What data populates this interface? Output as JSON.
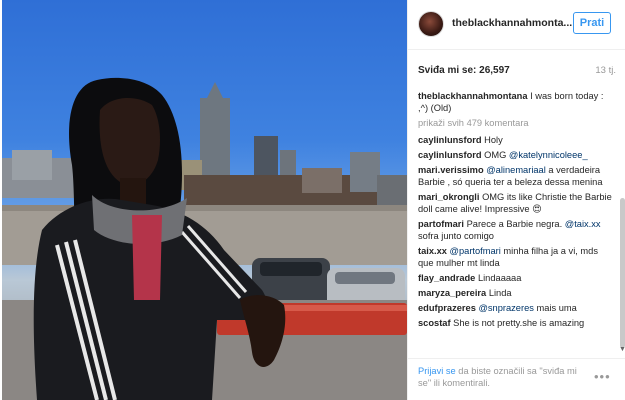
{
  "photo": {
    "alt_subject": "woman-on-parking-deck"
  },
  "header": {
    "username": "theblackhannahmonta...",
    "follow_label": "Prati"
  },
  "stats": {
    "likes_label": "Sviđa mi se: 26,597",
    "age": "13 tj."
  },
  "caption": {
    "user": "theblackhannahmontana",
    "text": " I was born today : ,^) (Old)"
  },
  "load_more": "prikaži svih 479 komentara",
  "comments": [
    {
      "user": "caylinlunsford",
      "pre": " Holy",
      "mention": "",
      "post": ""
    },
    {
      "user": "caylinlunsford",
      "pre": " OMG ",
      "mention": "@katelynnicoleee_",
      "post": ""
    },
    {
      "user": "mari.verissimo",
      "pre": " ",
      "mention": "@alinemariaal",
      "post": " a verdadeira Barbie , só queria ter a beleza dessa menina"
    },
    {
      "user": "mari_okrongli",
      "pre": " OMG its like Christie the Barbie doll came alive! Impressive 😍",
      "mention": "",
      "post": ""
    },
    {
      "user": "partofmari",
      "pre": " Parece a Barbie negra. ",
      "mention": "@taix.xx",
      "post": " sofra junto comigo"
    },
    {
      "user": "taix.xx",
      "pre": " ",
      "mention": "@partofmari",
      "post": " minha filha ja a vi, mds que mulher mt linda"
    },
    {
      "user": "flay_andrade",
      "pre": " Lindaaaaa",
      "mention": "",
      "post": ""
    },
    {
      "user": "maryza_pereira",
      "pre": " Linda",
      "mention": "",
      "post": ""
    },
    {
      "user": "edufprazeres",
      "pre": " ",
      "mention": "@snprazeres",
      "post": " mais uma"
    },
    {
      "user": "scostaf",
      "pre": " She is not pretty.she is amazing",
      "mention": "",
      "post": ""
    }
  ],
  "footer": {
    "login_link": "Prijavi se",
    "login_text": " da biste označili sa \"sviđa mi se\" ili komentirali.",
    "more_icon": "•••"
  },
  "colors": {
    "accent": "#3897f0",
    "mention": "#003569",
    "muted": "#999999"
  }
}
